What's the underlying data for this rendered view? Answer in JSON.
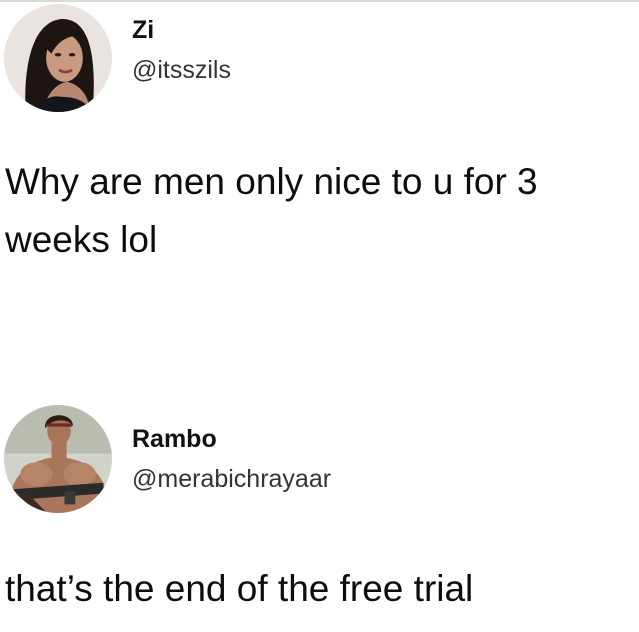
{
  "tweets": [
    {
      "avatar_icon": "avatar-portrait-woman",
      "display_name": "Zi",
      "handle": "@itsszils",
      "text": "Why are men only nice to u for 3 weeks lol"
    },
    {
      "avatar_icon": "avatar-portrait-muscular-man",
      "display_name": "Rambo",
      "handle": "@merabichrayaar",
      "text": "that’s the end of the free trial"
    }
  ],
  "colors": {
    "background": "#ffffff",
    "text": "#111111",
    "handle": "#333333"
  }
}
